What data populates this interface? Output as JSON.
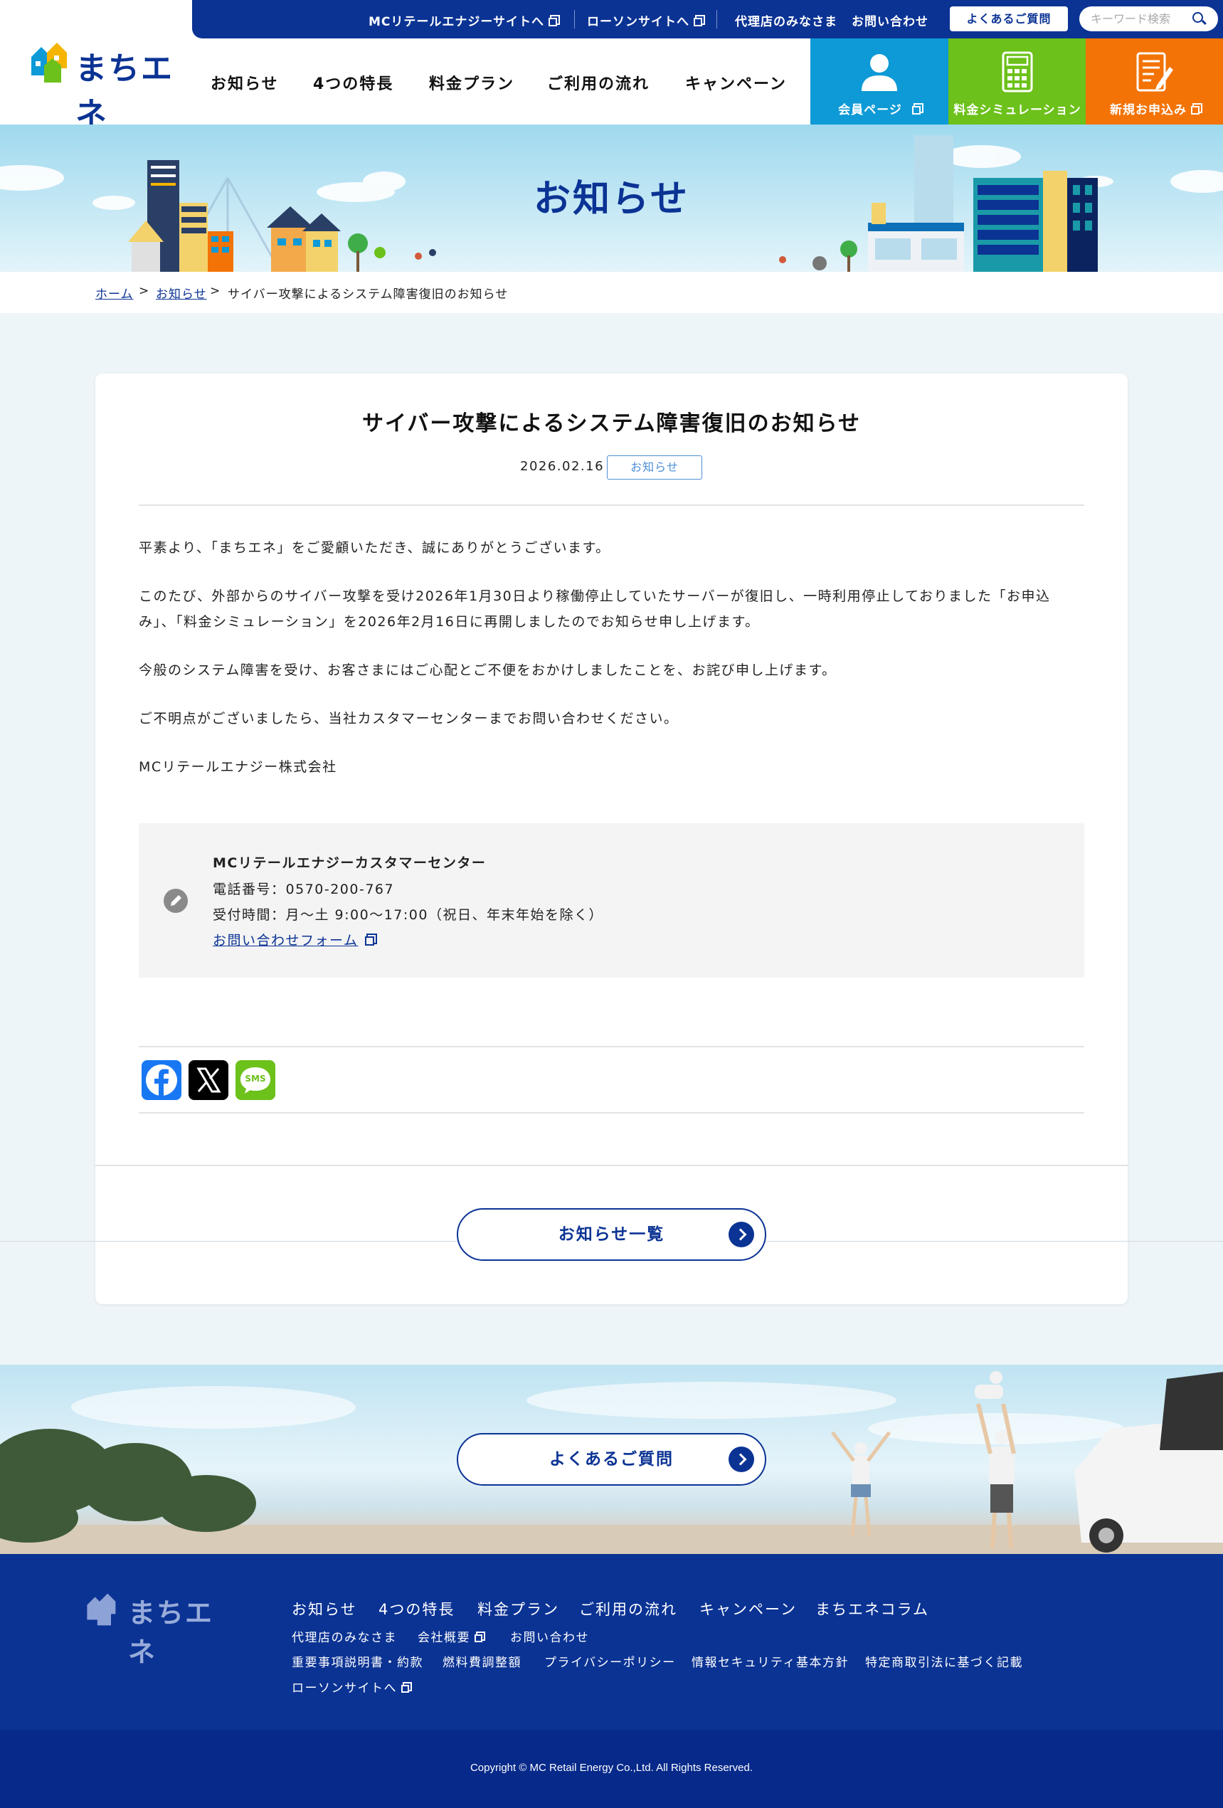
{
  "header": {
    "utility_links": [
      {
        "label": "MCリテールエナジーサイトへ",
        "external": true
      },
      {
        "label": "ローソンサイトへ",
        "external": true
      },
      {
        "label": "代理店のみなさま",
        "external": false
      },
      {
        "label": "お問い合わせ",
        "external": false
      }
    ],
    "faq_button": "よくあるご質問",
    "search_placeholder": "キーワード検索",
    "logo_text": "まちエネ",
    "nav": [
      "お知らせ",
      "4つの特長",
      "料金プラン",
      "ご利用の流れ",
      "キャンペーン"
    ],
    "cta": [
      {
        "label": "会員ページ",
        "color": "#0d9ad6",
        "icon": "user-icon"
      },
      {
        "label": "料金シミュレーション",
        "color": "#6cc11a",
        "icon": "calculator-icon"
      },
      {
        "label": "新規お申込み",
        "color": "#f37306",
        "icon": "application-form-icon"
      }
    ]
  },
  "hero": {
    "title": "お知らせ"
  },
  "breadcrumb": {
    "home": "ホーム",
    "news": "お知らせ",
    "current": "サイバー攻撃によるシステム障害復旧のお知らせ",
    "separator": ">"
  },
  "article": {
    "title": "サイバー攻撃によるシステム障害復旧のお知らせ",
    "date": "2026.02.16",
    "category": "お知らせ",
    "paragraphs": [
      "平素より、「まちエネ」をご愛顧いただき、誠にありがとうございます。",
      "このたび、外部からのサイバー攻撃を受け2026年1月30日より稼働停止していたサーバーが復旧し、一時利用停止しておりました「お申込み」、「料金シミュレーション」を2026年2月16日に再開しましたのでお知らせ申し上げます。",
      "今般のシステム障害を受け、お客さまにはご心配とご不便をおかけしましたことを、お詫び申し上げます。",
      "ご不明点がございましたら、当社カスタマーセンターまでお問い合わせください。",
      "MCリテールエナジー株式会社"
    ],
    "contact": {
      "name": "MCリテールエナジーカスタマーセンター",
      "phone": "電話番号：0570-200-767",
      "hours": "受付時間：月～土 9:00～17:00（祝日、年末年始を除く）",
      "form_link": "お問い合わせフォーム"
    },
    "share": [
      {
        "icon": "facebook-icon",
        "color": "#1877f2"
      },
      {
        "icon": "x-icon",
        "color": "#000000"
      },
      {
        "icon": "sms-icon",
        "color": "#6cc11a",
        "label": "SMS"
      }
    ]
  },
  "news_list_button": "お知らせ一覧",
  "faq_banner_button": "よくあるご質問",
  "footer": {
    "logo_text": "まちエネ",
    "nav": [
      "お知らせ",
      "4つの特長",
      "料金プラン",
      "ご利用の流れ",
      "キャンペーン",
      "まちエネコラム"
    ],
    "links_row1": [
      "代理店のみなさま",
      "会社概要",
      "お問い合わせ"
    ],
    "links_row2": [
      "重要事項説明書・約款",
      "燃料費調整額",
      "プライバシーポリシー",
      "情報セキュリティ基本方針",
      "特定商取引法に基づく記載"
    ],
    "links_row3": [
      "ローソンサイトへ"
    ],
    "copyright": "Copyright © MC Retail Energy Co.,Ltd. All Rights Reserved."
  },
  "colors": {
    "brand_navy": "#0b3394",
    "page_bg": "#eef5f8"
  }
}
